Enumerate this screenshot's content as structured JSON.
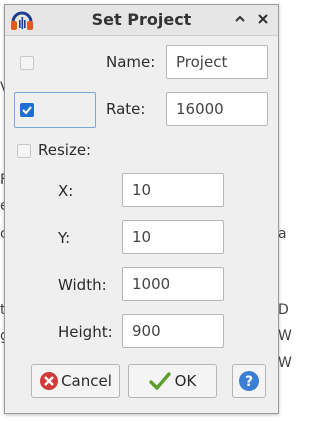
{
  "dialog": {
    "title": "Set Project",
    "minimize_glyph": "^",
    "close_glyph": "×"
  },
  "form": {
    "name": {
      "label": "Name:",
      "value": "Project",
      "checked": false
    },
    "rate": {
      "label": "Rate:",
      "value": "16000",
      "checked": true
    },
    "resize": {
      "label": "Resize:",
      "checked": false
    },
    "x": {
      "label": "X:",
      "value": "10"
    },
    "y": {
      "label": "Y:",
      "value": "10"
    },
    "width": {
      "label": "Width:",
      "value": "1000"
    },
    "height": {
      "label": "Height:",
      "value": "900"
    }
  },
  "buttons": {
    "cancel": "Cancel",
    "ok": "OK",
    "help": "?"
  },
  "background_fragments": [
    "V",
    "F",
    "e",
    "c",
    "a",
    "t",
    "D",
    "g",
    "W",
    "W"
  ],
  "colors": {
    "cancel_icon": "#d33b3b",
    "ok_icon": "#5aa02c",
    "help_icon": "#3b7fd4",
    "checkbox_accent": "#1f6fd0"
  },
  "icons": {
    "app": "audacity-headphones-icon",
    "cancel": "red-x-circle-icon",
    "ok": "green-checkmark-icon",
    "help": "blue-question-circle-icon"
  }
}
